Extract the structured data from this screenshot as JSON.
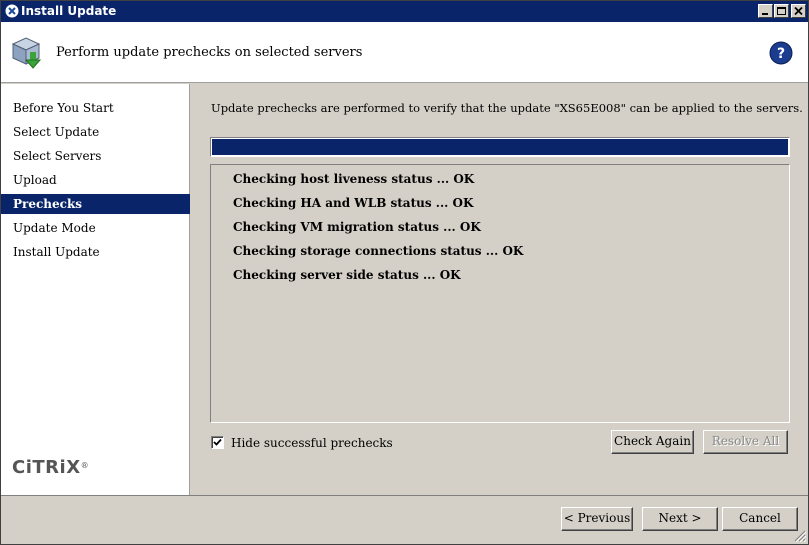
{
  "window": {
    "title": "Install Update"
  },
  "header": {
    "heading": "Perform update prechecks on selected servers"
  },
  "sidebar": {
    "steps": [
      {
        "label": "Before You Start"
      },
      {
        "label": "Select Update"
      },
      {
        "label": "Select Servers"
      },
      {
        "label": "Upload"
      },
      {
        "label": "Prechecks"
      },
      {
        "label": "Update Mode"
      },
      {
        "label": "Install Update"
      }
    ],
    "active_step": "Prechecks",
    "logo_text": "CiTRiX",
    "logo_mark": "®"
  },
  "main": {
    "intro": "Update prechecks are performed to verify that the update \"XS65E008\" can be applied to the servers.",
    "progress_percent": 100,
    "results": [
      "Checking host liveness status ... OK",
      "Checking HA and WLB status ... OK",
      "Checking VM migration status ... OK",
      "Checking storage connections status ... OK",
      "Checking server side status ... OK"
    ],
    "hide_successful": {
      "label": "Hide successful prechecks",
      "checked": true
    },
    "check_again_label": "Check Again",
    "resolve_all_label": "Resolve All"
  },
  "footer": {
    "previous_label": "< Previous",
    "next_label": "Next >",
    "cancel_label": "Cancel"
  },
  "colors": {
    "titlebar": "#0a246a",
    "selection": "#0a246a",
    "progress": "#0a246a",
    "face": "#d4d0c8"
  },
  "icons": [
    "app-icon",
    "minimize-icon",
    "maximize-icon",
    "close-icon",
    "wizard-icon",
    "help-icon",
    "checkmark-icon",
    "size-grip-icon"
  ]
}
